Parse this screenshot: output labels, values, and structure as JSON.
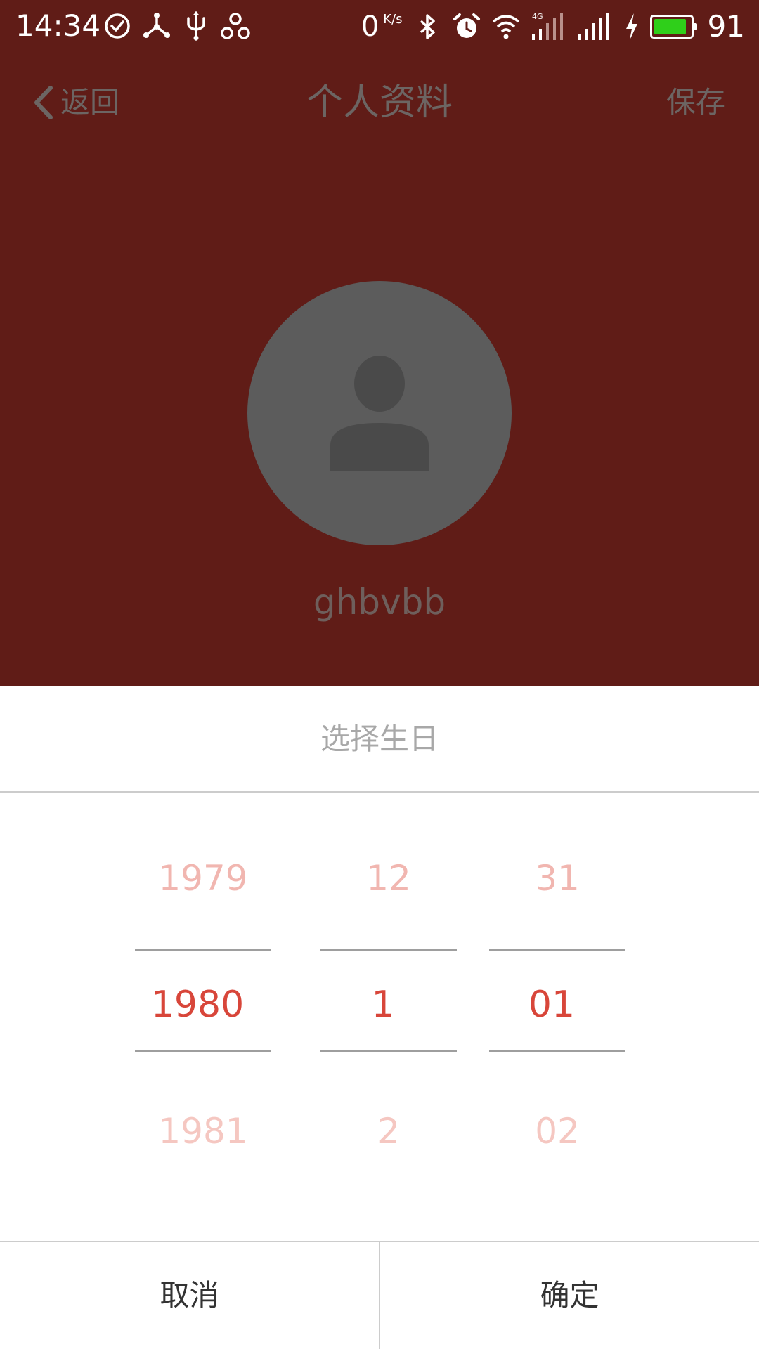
{
  "status_bar": {
    "time": "14:34",
    "left_icons": [
      "check-circle-icon",
      "share-node-icon",
      "usb-icon",
      "link-nodes-icon"
    ],
    "net_speed_value": "0",
    "net_speed_unit": "K/s",
    "right_icons": [
      "bluetooth-icon",
      "alarm-icon",
      "wifi-icon",
      "signal-4g-icon",
      "signal-icon",
      "charging-icon"
    ],
    "network_type": "4G",
    "battery_percent": "91",
    "battery_level": 0.91,
    "battery_color": "#2fcf1a"
  },
  "header": {
    "back_label": "返回",
    "title": "个人资料",
    "save_label": "保存"
  },
  "profile": {
    "username": "ghbvbb"
  },
  "date_picker": {
    "title": "选择生日",
    "year": {
      "prev": "1979",
      "selected": "1980",
      "next": "1981"
    },
    "month": {
      "prev": "12",
      "selected": "1",
      "next": "2"
    },
    "day": {
      "prev": "31",
      "selected": "01",
      "next": "02"
    },
    "cancel_label": "取消",
    "confirm_label": "确定"
  },
  "colors": {
    "overlay_bg": "#601c17",
    "selected_text": "#d8463a",
    "unselected_text": "#f1b6b0"
  }
}
